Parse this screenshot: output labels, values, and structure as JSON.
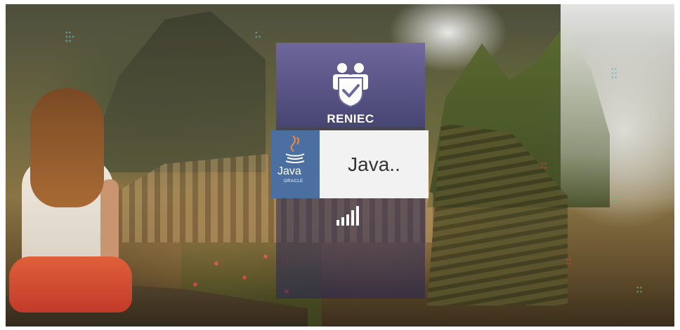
{
  "background": {
    "description_colors": {
      "sky_mist": "#ebebeb",
      "mountain": "#4d4f3c",
      "ruins": "#8a7445"
    }
  },
  "splash": {
    "brand_label": "RENIEC",
    "brand_icon": "reniec-shield-people-icon",
    "loading_text": "Java..",
    "java_logo_text": "Java",
    "java_logo_subtext": "ORACLE",
    "loading_indicator_icon": "signal-bars-icon",
    "colors": {
      "panel": "#3a3a6e",
      "panel_top": "#7a6eaa",
      "java_box": "#4a6fa0",
      "text_box": "#f2f2f2"
    }
  }
}
